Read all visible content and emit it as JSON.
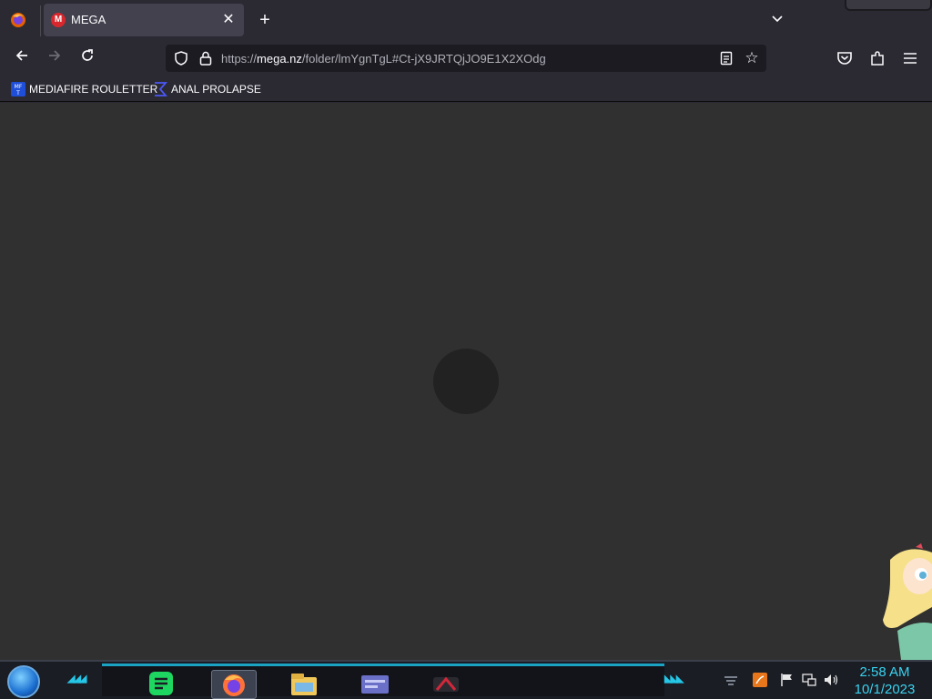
{
  "tabs": [
    {
      "title": "MEGA",
      "favicon_letter": "M",
      "active": true
    }
  ],
  "navigation": {
    "url_scheme": "https://",
    "url_host": "mega.nz",
    "url_path": "/folder/lmYgnTgL#Ct-jX9JRTQjJO9E1X2XOdg"
  },
  "bookmarks": [
    {
      "label": "MEDIAFIRE ROULETTER",
      "icon": "mediafire-icon"
    },
    {
      "label": "ANAL PROLAPSE",
      "icon": "sigma-icon"
    }
  ],
  "taskbar": {
    "items": [
      "notes-icon",
      "firefox-icon",
      "file-explorer-icon",
      "card-app-icon",
      "game-app-icon"
    ],
    "clock_time": "2:58 AM",
    "clock_date": "10/1/2023"
  },
  "colors": {
    "page_bg": "#303030",
    "chrome_bg": "#2b2a33",
    "clock": "#39d2f0",
    "mega_red": "#d9272e"
  }
}
